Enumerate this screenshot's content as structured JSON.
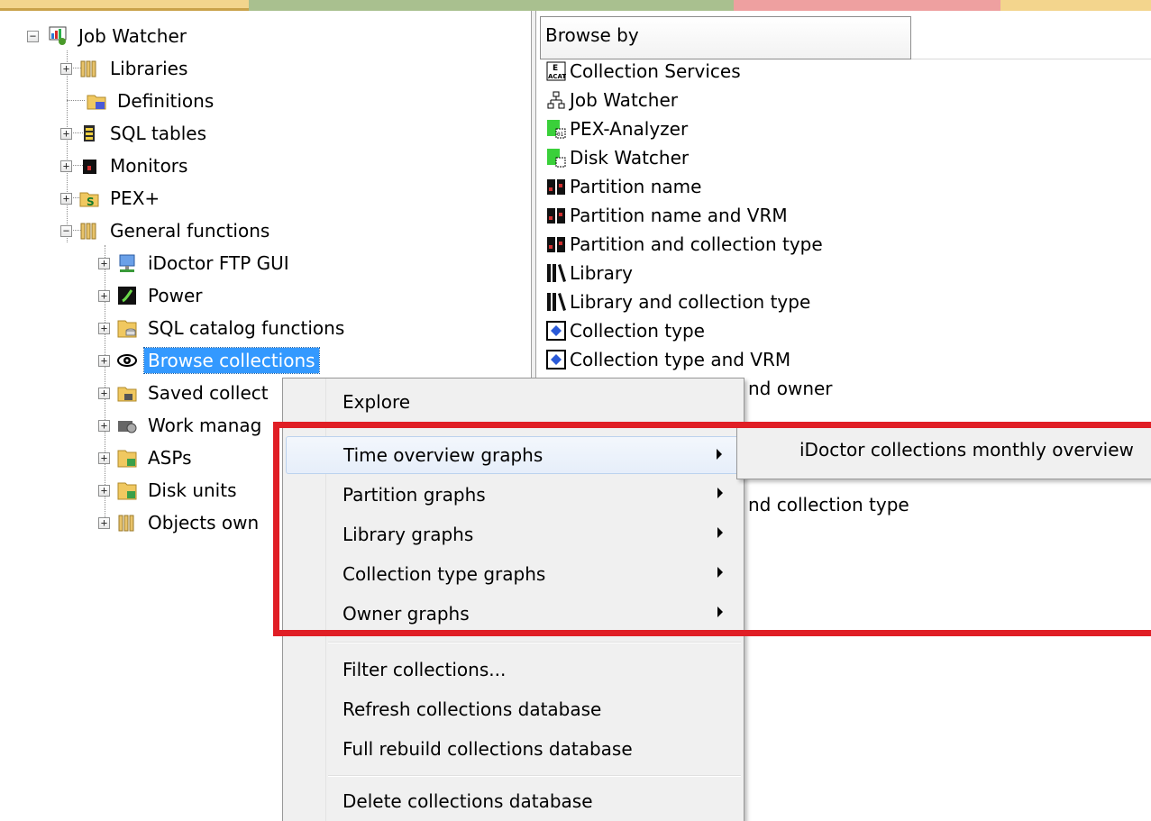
{
  "colors": {
    "selection": "#3399ff",
    "highlight_box": "#e01e25",
    "menu_bg": "#f0f0f0",
    "top_strip": [
      "#f3d58d",
      "#a9c08f",
      "#cfd2a4",
      "#eea0a0",
      "#f3d58d"
    ]
  },
  "tree": {
    "root": {
      "label": "Job Watcher",
      "icon": "job-watcher-icon"
    },
    "items": [
      {
        "label": "Libraries",
        "icon": "library-icon"
      },
      {
        "label": "Definitions",
        "icon": "definitions-folder-icon"
      },
      {
        "label": "SQL tables",
        "icon": "sql-table-icon"
      },
      {
        "label": "Monitors",
        "icon": "monitor-icon"
      },
      {
        "label": "PEX+",
        "icon": "pex-plus-icon"
      },
      {
        "label": "General functions",
        "icon": "library-icon"
      }
    ],
    "children": [
      {
        "label": "iDoctor FTP GUI",
        "icon": "ftp-icon"
      },
      {
        "label": "Power",
        "icon": "power-icon"
      },
      {
        "label": "SQL catalog functions",
        "icon": "folder-database-icon"
      },
      {
        "label": "Browse collections",
        "icon": "eye-icon"
      },
      {
        "label": "Saved collect",
        "icon": "saved-folder-icon"
      },
      {
        "label": "Work manag",
        "icon": "work-management-icon"
      },
      {
        "label": "ASPs",
        "icon": "folder-database-icon"
      },
      {
        "label": "Disk units",
        "icon": "folder-database-icon"
      },
      {
        "label": "Objects own",
        "icon": "library-icon"
      }
    ]
  },
  "list": {
    "header": "Browse by",
    "items": [
      {
        "label": "Collection Services",
        "icon": "collection-services-icon"
      },
      {
        "label": "Job Watcher",
        "icon": "hierarchy-icon"
      },
      {
        "label": "PEX-Analyzer",
        "icon": "pex-analyzer-icon"
      },
      {
        "label": "Disk Watcher",
        "icon": "disk-watcher-icon"
      },
      {
        "label": "Partition name",
        "icon": "partition-icon"
      },
      {
        "label": "Partition name and VRM",
        "icon": "partition-icon"
      },
      {
        "label": "Partition and collection type",
        "icon": "partition-icon"
      },
      {
        "label": "Library",
        "icon": "books-icon"
      },
      {
        "label": "Library and collection type",
        "icon": "books-icon"
      },
      {
        "label": "Collection type",
        "icon": "collection-type-icon"
      },
      {
        "label": "Collection type and VRM",
        "icon": "collection-type-icon"
      },
      {
        "label": "nd owner",
        "icon": ""
      },
      {
        "label": "nd collection type",
        "icon": ""
      }
    ]
  },
  "menu": {
    "explore": "Explore",
    "graph_items": [
      "Time overview graphs",
      "Partition graphs",
      "Library graphs",
      "Collection type graphs",
      "Owner graphs"
    ],
    "db_items": [
      "Filter collections...",
      "Refresh collections database",
      "Full rebuild collections database"
    ],
    "delete": "Delete collections database"
  },
  "submenu": {
    "item": "iDoctor collections monthly overview"
  }
}
